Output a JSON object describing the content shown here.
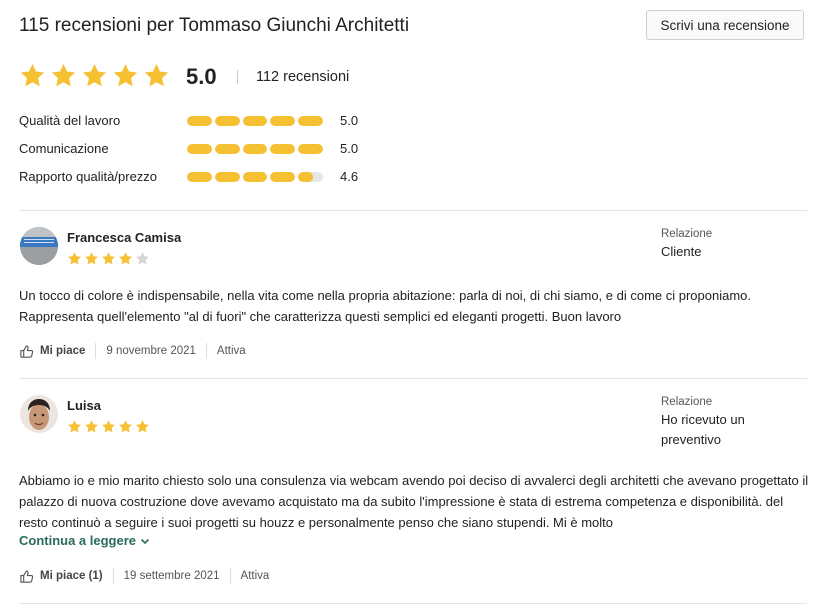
{
  "header": {
    "title": "115 recensioni per Tommaso Giunchi Architetti",
    "write_review_label": "Scrivi una recensione"
  },
  "summary": {
    "average": "5.0",
    "average_stars": 5,
    "reviews_count": "112 recensioni",
    "metrics": [
      {
        "label": "Qualità del lavoro",
        "value": "5.0",
        "score": 5.0
      },
      {
        "label": "Comunicazione",
        "value": "5.0",
        "score": 5.0
      },
      {
        "label": "Rapporto qualità/prezzo",
        "value": "4.6",
        "score": 4.6
      }
    ]
  },
  "reviews": [
    {
      "name": "Francesca Camisa",
      "rating": 4,
      "relation_label": "Relazione",
      "relation_value": "Cliente",
      "text": "Un tocco di colore è indispensabile, nella vita come nella propria abitazione: parla di noi, di chi siamo, e di come ci proponiamo. Rappresenta quell'elemento \"al di fuori\"  che caratterizza questi semplici ed eleganti progetti. Buon lavoro",
      "like_label": "Mi piace",
      "date": "9 novembre 2021",
      "status": "Attiva"
    },
    {
      "name": "Luisa",
      "rating": 5,
      "relation_label": "Relazione",
      "relation_value": "Ho ricevuto un preventivo",
      "text": "Abbiamo io e mio marito chiesto solo una consulenza via webcam avendo poi deciso di avvalerci degli architetti che avevano progettato il palazzo di nuova costruzione dove avevamo acquistato ma da subito l'impressione è stata di estrema competenza e disponibilità. del resto continuò a seguire i suoi progetti su houzz e personalmente penso che siano stupendi. Mi è molto",
      "read_more_label": "Continua a leggere",
      "like_label": "Mi piace (1)",
      "date": "19 settembre 2021",
      "status": "Attiva"
    }
  ],
  "colors": {
    "star": "#f6c033",
    "star_empty": "#d6d6d6",
    "link": "#2a6b5b"
  }
}
